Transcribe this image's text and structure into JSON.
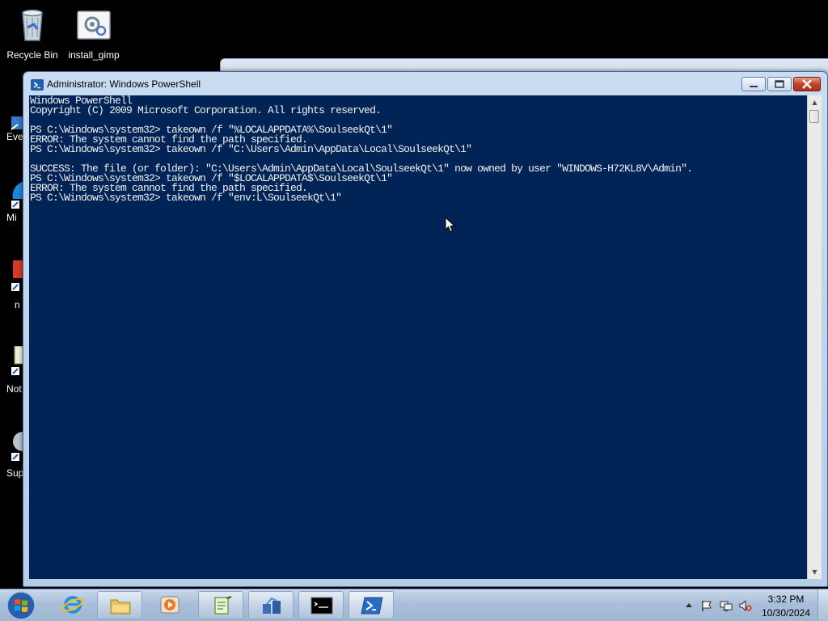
{
  "desktop": {
    "icons": [
      {
        "label": "Recycle Bin",
        "icon": "recycle-bin-icon"
      },
      {
        "label": "install_gimp",
        "icon": "installer-icon"
      }
    ],
    "side_icons": [
      {
        "label": "Eve",
        "icon": "event-viewer-icon"
      },
      {
        "label": "Mi",
        "icon": "edge-shortcut-icon"
      },
      {
        "label": "n",
        "icon": "app-shortcut-icon"
      },
      {
        "label": "Not",
        "icon": "notepad-shortcut-icon"
      },
      {
        "label": "Sup",
        "icon": "support-shortcut-icon"
      }
    ]
  },
  "window": {
    "title": "Administrator: Windows PowerShell",
    "icon": "powershell-icon",
    "controls": [
      "minimize-icon",
      "maximize-icon",
      "close-icon"
    ]
  },
  "console": {
    "lines": [
      "Windows PowerShell",
      "Copyright (C) 2009 Microsoft Corporation. All rights reserved.",
      "",
      "PS C:\\Windows\\system32> takeown /f \"%LOCALAPPDATA%\\SoulseekQt\\1\"",
      "ERROR: The system cannot find the path specified.",
      "PS C:\\Windows\\system32> takeown /f \"C:\\Users\\Admin\\AppData\\Local\\SoulseekQt\\1\"",
      "",
      "SUCCESS: The file (or folder): \"C:\\Users\\Admin\\AppData\\Local\\SoulseekQt\\1\" now owned by user \"WINDOWS-H72KL8V\\Admin\".",
      "PS C:\\Windows\\system32> takeown /f \"$LOCALAPPDATA$\\SoulseekQt\\1\"",
      "ERROR: The system cannot find the path specified.",
      "PS C:\\Windows\\system32> takeown /f \"env:L\\SoulseekQt\\1\""
    ],
    "background": "#012456",
    "foreground": "#f2f2f2"
  },
  "taskbar": {
    "start_icon": "windows-start-icon",
    "pinned": [
      {
        "name": "internet-explorer",
        "icon": "internet-explorer-icon"
      },
      {
        "name": "file-explorer",
        "icon": "folder-icon"
      },
      {
        "name": "media-player",
        "icon": "media-player-icon"
      },
      {
        "name": "notepad-plus-plus",
        "icon": "notepad-plus-plus-icon"
      },
      {
        "name": "network-app",
        "icon": "network-share-icon"
      },
      {
        "name": "command-prompt",
        "icon": "cmd-icon"
      },
      {
        "name": "powershell",
        "icon": "powershell-icon"
      }
    ],
    "tray": {
      "icons": [
        "show-hidden-arrow-icon",
        "action-center-flag-icon",
        "network-icon",
        "volume-muted-icon"
      ],
      "time": "3:32 PM",
      "date": "10/30/2024"
    }
  }
}
